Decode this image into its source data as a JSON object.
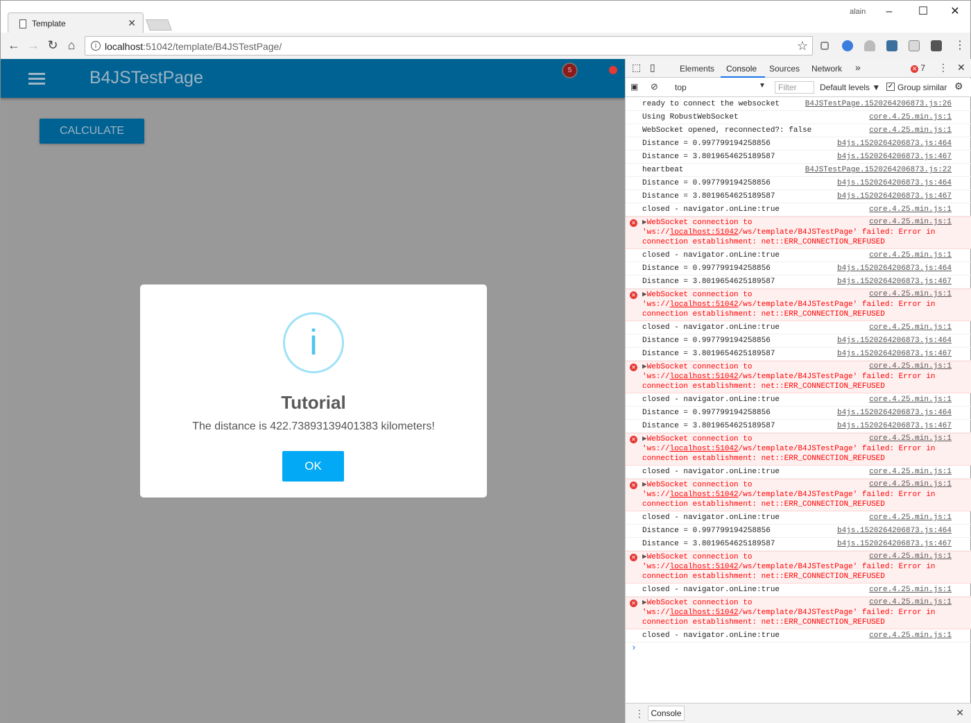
{
  "browser": {
    "tab_title": "Template",
    "tab_close": "✕",
    "window_user": "alain",
    "url_host": "localhost",
    "url_rest": ":51042/template/B4JSTestPage/"
  },
  "app": {
    "title": "B4JSTestPage",
    "notification_count": "5",
    "calculate_label": "CALCULATE",
    "accent_color": "#006293"
  },
  "dialog": {
    "icon": "i",
    "title": "Tutorial",
    "message": "The distance is 422.73893139401383 kilometers!",
    "ok_label": "OK"
  },
  "devtools": {
    "tabs": [
      "Elements",
      "Console",
      "Sources",
      "Network"
    ],
    "active_tab": "Console",
    "error_count": "7",
    "context": "top",
    "filter_placeholder": "Filter",
    "levels": "Default levels",
    "group_similar": "Group similar",
    "drawer_tab": "Console",
    "log": [
      {
        "type": "log",
        "msg": "ready to connect the websocket",
        "src": "B4JSTestPage.1520264206873.js:26"
      },
      {
        "type": "log",
        "msg": "Using RobustWebSocket",
        "src": "core.4.25.min.js:1"
      },
      {
        "type": "log",
        "msg": "WebSocket opened, reconnected?: false",
        "src": "core.4.25.min.js:1"
      },
      {
        "type": "log",
        "msg": "Distance = 0.997799194258856",
        "src": "b4js.1520264206873.js:464"
      },
      {
        "type": "log",
        "msg": "Distance = 3.8019654625189587",
        "src": "b4js.1520264206873.js:467"
      },
      {
        "type": "log",
        "msg": "heartbeat",
        "src": "B4JSTestPage.1520264206873.js:22"
      },
      {
        "type": "log",
        "msg": "Distance = 0.997799194258856",
        "src": "b4js.1520264206873.js:464"
      },
      {
        "type": "log",
        "msg": "Distance = 3.8019654625189587",
        "src": "b4js.1520264206873.js:467"
      },
      {
        "type": "log",
        "msg": "closed - navigator.onLine:true",
        "src": "core.4.25.min.js:1"
      },
      {
        "type": "err",
        "src": "core.4.25.min.js:1"
      },
      {
        "type": "log",
        "msg": "closed - navigator.onLine:true",
        "src": "core.4.25.min.js:1"
      },
      {
        "type": "log",
        "msg": "Distance = 0.997799194258856",
        "src": "b4js.1520264206873.js:464"
      },
      {
        "type": "log",
        "msg": "Distance = 3.8019654625189587",
        "src": "b4js.1520264206873.js:467"
      },
      {
        "type": "err",
        "src": "core.4.25.min.js:1"
      },
      {
        "type": "log",
        "msg": "closed - navigator.onLine:true",
        "src": "core.4.25.min.js:1"
      },
      {
        "type": "log",
        "msg": "Distance = 0.997799194258856",
        "src": "b4js.1520264206873.js:464"
      },
      {
        "type": "log",
        "msg": "Distance = 3.8019654625189587",
        "src": "b4js.1520264206873.js:467"
      },
      {
        "type": "err",
        "src": "core.4.25.min.js:1"
      },
      {
        "type": "log",
        "msg": "closed - navigator.onLine:true",
        "src": "core.4.25.min.js:1"
      },
      {
        "type": "log",
        "msg": "Distance = 0.997799194258856",
        "src": "b4js.1520264206873.js:464"
      },
      {
        "type": "log",
        "msg": "Distance = 3.8019654625189587",
        "src": "b4js.1520264206873.js:467"
      },
      {
        "type": "err",
        "src": "core.4.25.min.js:1"
      },
      {
        "type": "log",
        "msg": "closed - navigator.onLine:true",
        "src": "core.4.25.min.js:1"
      },
      {
        "type": "err",
        "src": "core.4.25.min.js:1"
      },
      {
        "type": "log",
        "msg": "closed - navigator.onLine:true",
        "src": "core.4.25.min.js:1"
      },
      {
        "type": "log",
        "msg": "Distance = 0.997799194258856",
        "src": "b4js.1520264206873.js:464"
      },
      {
        "type": "log",
        "msg": "Distance = 3.8019654625189587",
        "src": "b4js.1520264206873.js:467"
      },
      {
        "type": "err",
        "src": "core.4.25.min.js:1"
      },
      {
        "type": "log",
        "msg": "closed - navigator.onLine:true",
        "src": "core.4.25.min.js:1"
      },
      {
        "type": "err",
        "src": "core.4.25.min.js:1"
      },
      {
        "type": "log",
        "msg": "closed - navigator.onLine:true",
        "src": "core.4.25.min.js:1"
      }
    ],
    "error_text": {
      "line1": "WebSocket connection to",
      "line2a": "'ws://",
      "line2b": "localhost:51042",
      "line2c": "/ws/template/B4JSTestPage' failed: Error in",
      "line3": "connection establishment: net::ERR_CONNECTION_REFUSED"
    },
    "prompt": "›"
  }
}
